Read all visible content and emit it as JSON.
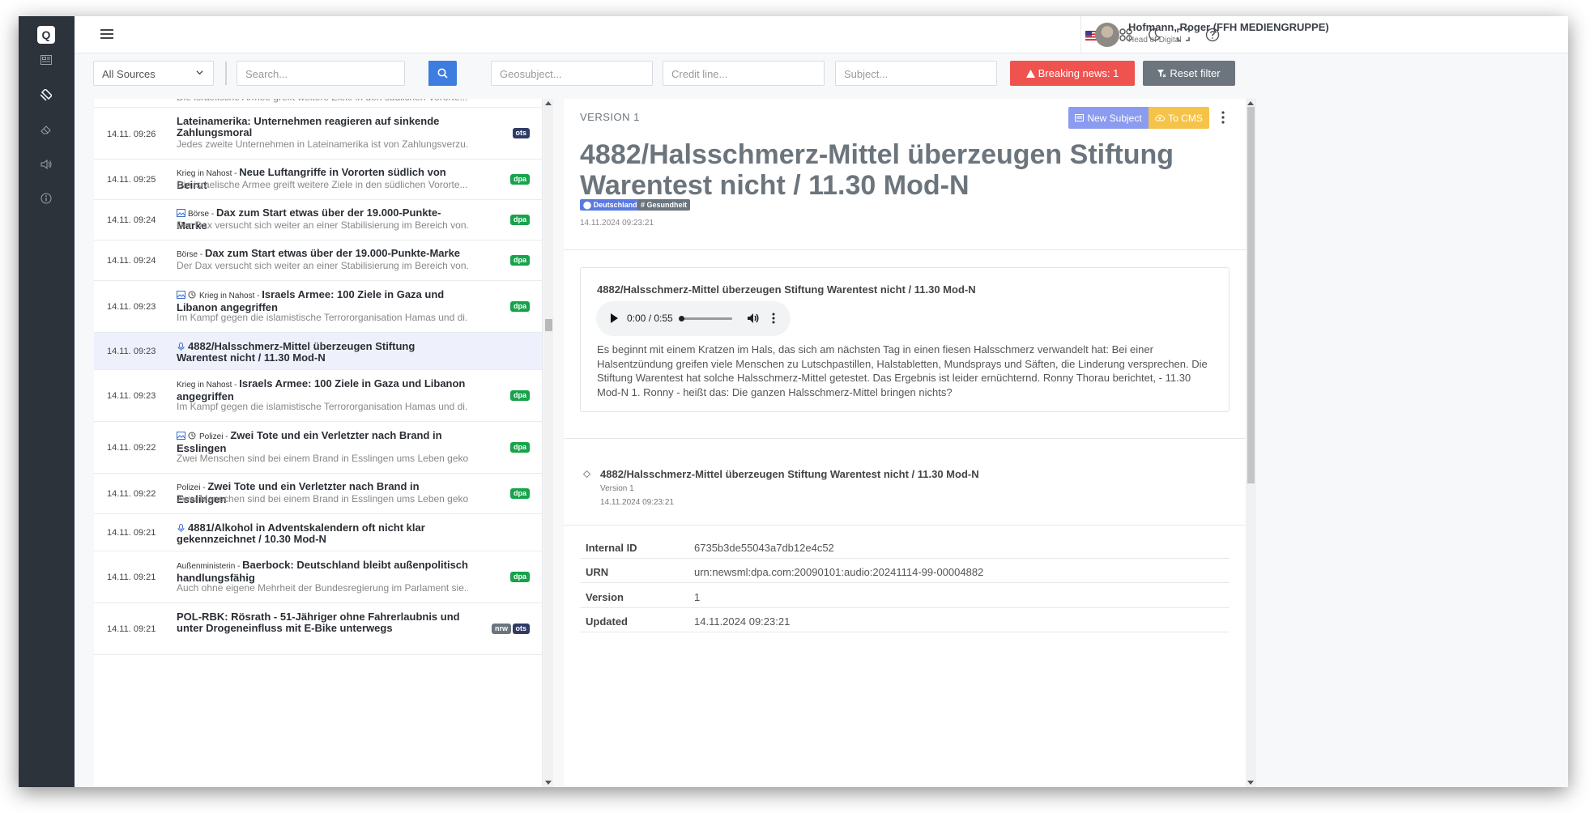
{
  "topbar": {
    "user_name": "Hofmann, Roger (FFH MEDIENGRUPPE)",
    "user_role": "Head of Digital"
  },
  "filters": {
    "source_value": "All Sources",
    "search_placeholder": "Search...",
    "geo_placeholder": "Geosubject...",
    "credit_placeholder": "Credit line...",
    "subject_placeholder": "Subject...",
    "breaking_label": "Breaking news: 1",
    "reset_label": "Reset filter"
  },
  "list": {
    "partial_top": "Die israelische Armee greift weitere Ziele in den südlichen Vororte...",
    "items": [
      {
        "time": "14.11. 09:26",
        "category": "",
        "title": "Lateinamerika: Unternehmen reagieren auf sinkende Zahlungsmoral",
        "summary": "Jedes zweite Unternehmen in Lateinamerika ist von Zahlungsverzu...",
        "badge": "ots"
      },
      {
        "time": "14.11. 09:25",
        "category": "Krieg in Nahost",
        "title": "Neue Luftangriffe in Vororten südlich von Beirut",
        "summary": "Die israelische Armee greift weitere Ziele in den südlichen Vororte...",
        "badge": "dpa"
      },
      {
        "time": "14.11. 09:24",
        "category": "Börse",
        "title": "Dax zum Start etwas über der 19.000-Punkte-Marke",
        "summary": "Der Dax versucht sich weiter an einer Stabilisierung im Bereich von...",
        "badge": "dpa"
      },
      {
        "time": "14.11. 09:24",
        "category": "Börse",
        "title": "Dax zum Start etwas über der 19.000-Punkte-Marke",
        "summary": "Der Dax versucht sich weiter an einer Stabilisierung im Bereich von...",
        "badge": "dpa"
      },
      {
        "time": "14.11. 09:23",
        "category": "Krieg in Nahost",
        "title": "Israels Armee: 100 Ziele in Gaza und Libanon angegriffen",
        "summary": "Im Kampf gegen die islamistische Terrororganisation Hamas und di...",
        "badge": "dpa"
      },
      {
        "time": "14.11. 09:23",
        "category": "",
        "title": "4882/Halsschmerz-Mittel überzeugen Stiftung Warentest nicht / 11.30 Mod-N",
        "summary": "",
        "badge": ""
      },
      {
        "time": "14.11. 09:23",
        "category": "Krieg in Nahost",
        "title": "Israels Armee: 100 Ziele in Gaza und Libanon angegriffen",
        "summary": "Im Kampf gegen die islamistische Terrororganisation Hamas und di...",
        "badge": "dpa"
      },
      {
        "time": "14.11. 09:22",
        "category": "Polizei",
        "title": "Zwei Tote und ein Verletzter nach Brand in Esslingen",
        "summary": "Zwei Menschen sind bei einem Brand in Esslingen ums Leben geko...",
        "badge": "dpa"
      },
      {
        "time": "14.11. 09:22",
        "category": "Polizei",
        "title": "Zwei Tote und ein Verletzter nach Brand in Esslingen",
        "summary": "Zwei Menschen sind bei einem Brand in Esslingen ums Leben geko...",
        "badge": "dpa"
      },
      {
        "time": "14.11. 09:21",
        "category": "",
        "title": "4881/Alkohol in Adventskalendern oft nicht klar gekennzeichnet / 10.30 Mod-N",
        "summary": "",
        "badge": ""
      },
      {
        "time": "14.11. 09:21",
        "category": "Außenministerin",
        "title": "Baerbock: Deutschland bleibt außenpolitisch handlungsfähig",
        "summary": "Auch ohne eigene Mehrheit der Bundesregierung im Parlament sie...",
        "badge": "dpa"
      },
      {
        "time": "14.11. 09:21",
        "category": "",
        "title": "POL-RBK: Rösrath - 51-Jähriger ohne Fahrerlaubnis und unter Drogeneinfluss mit E-Bike unterwegs",
        "summary": "",
        "badge": "ots",
        "badge2": "nrw"
      }
    ]
  },
  "detail": {
    "version_label": "VERSION 1",
    "new_subject_label": "New Subject",
    "to_cms_label": "To CMS",
    "headline": "4882/Halsschmerz-Mittel überzeugen Stiftung Warentest nicht / 11.30 Mod-N",
    "tag_geo": "Deutschland",
    "tag_subject": "Gesundheit",
    "date": "14.11.2024 09:23:21",
    "card_title": "4882/Halsschmerz-Mittel überzeugen Stiftung Warentest nicht / 11.30 Mod-N",
    "player_time": "0:00 / 0:55",
    "body": "Es beginnt mit einem Kratzen im Hals, das sich am nächsten Tag in einen fiesen Halsschmerz verwandelt hat: Bei einer Halsentzündung greifen viele Menschen zu Lutschpastillen, Halstabletten, Mundsprays und Säften, die Linderung versprechen. Die Stiftung Warentest hat solche Halsschmerz-Mittel getestet. Das Ergebnis ist leider ernüchternd. Ronny Thorau berichtet, - 11.30 Mod-N 1. Ronny - heißt das: Die ganzen Halsschmerz-Mittel bringen nichts?",
    "history_title": "4882/Halsschmerz-Mittel überzeugen Stiftung Warentest nicht / 11.30 Mod-N",
    "history_version": "Version 1",
    "history_date": "14.11.2024 09:23:21",
    "meta": [
      {
        "key": "Internal ID",
        "value": "6735b3de55043a7db12e4c52"
      },
      {
        "key": "URN",
        "value": "urn:newsml:dpa.com:20090101:audio:20241114-99-00004882"
      },
      {
        "key": "Version",
        "value": "1"
      },
      {
        "key": "Updated",
        "value": "14.11.2024 09:23:21"
      }
    ]
  }
}
